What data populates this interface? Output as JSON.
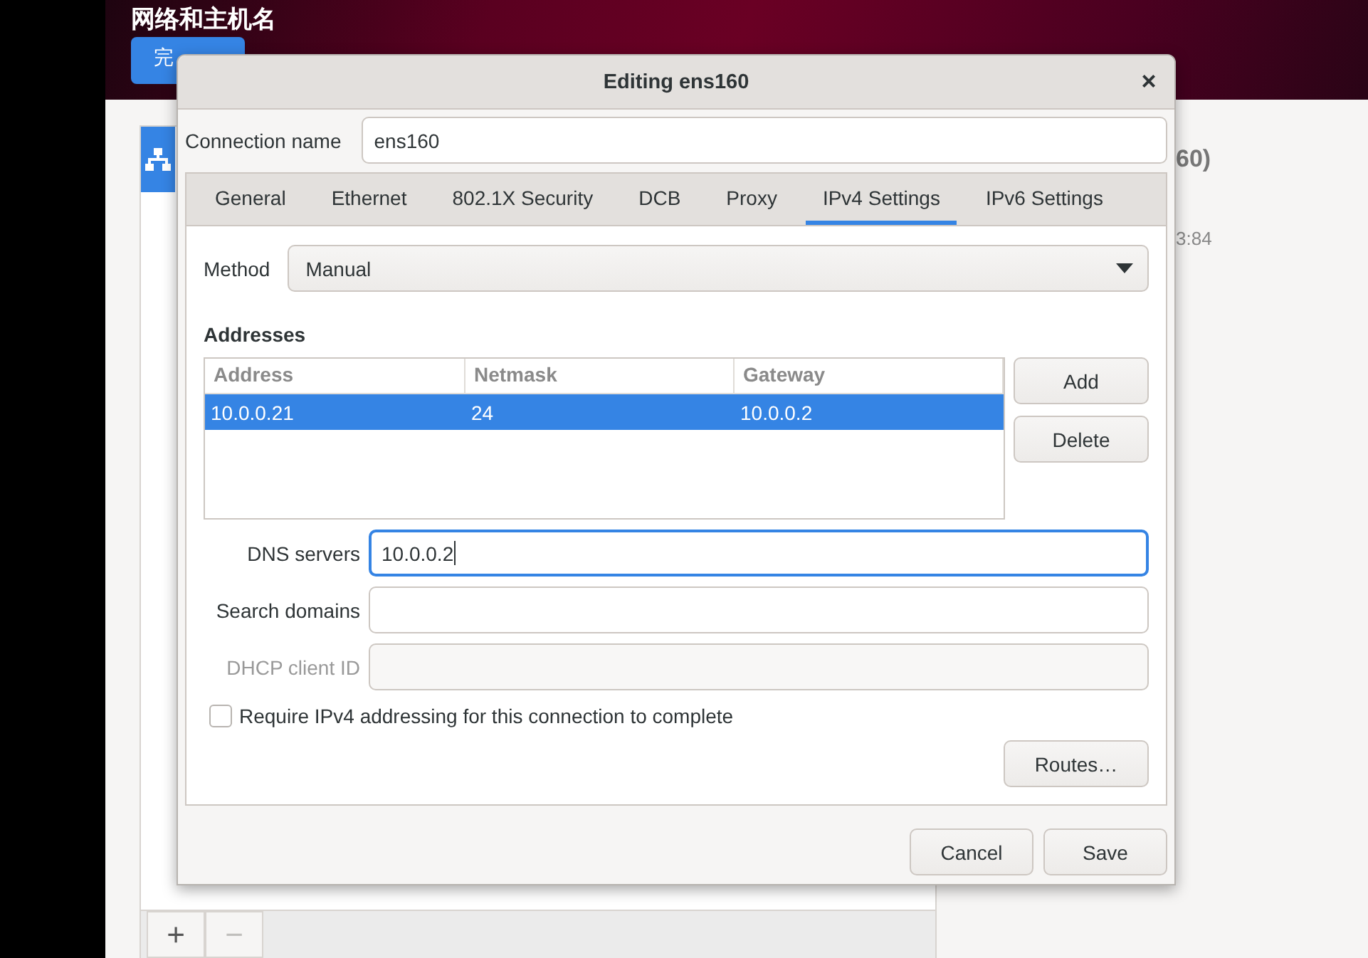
{
  "background": {
    "title": "网络和主机名",
    "done_button": "完",
    "list_item": {
      "selected": true
    },
    "partial_texts": [
      "60)",
      "3:84"
    ],
    "list_buttons": [
      {
        "label": "+",
        "disabled": false
      },
      {
        "label": "−",
        "disabled": true
      }
    ]
  },
  "dialog": {
    "title": "Editing ens160",
    "close": "×",
    "connection_name_label": "Connection name",
    "connection_name": "ens160",
    "tabs": [
      {
        "label": "General",
        "selected": false
      },
      {
        "label": "Ethernet",
        "selected": false
      },
      {
        "label": "802.1X Security",
        "selected": false
      },
      {
        "label": "DCB",
        "selected": false
      },
      {
        "label": "Proxy",
        "selected": false
      },
      {
        "label": "IPv4 Settings",
        "selected": true
      },
      {
        "label": "IPv6 Settings",
        "selected": false
      }
    ],
    "method_label": "Method",
    "method": "Manual",
    "addresses_heading": "Addresses",
    "columns": [
      "Address",
      "Netmask",
      "Gateway"
    ],
    "rows": [
      {
        "cells": [
          "10.0.0.21",
          "24",
          "10.0.0.2"
        ],
        "selected": true
      }
    ],
    "address_buttons": [
      "Add",
      "Delete"
    ],
    "fields": [
      {
        "label": "DNS servers",
        "value": "10.0.0.2",
        "focused": true,
        "disabled": false
      },
      {
        "label": "Search domains",
        "focused": false,
        "disabled": false
      },
      {
        "label": "DHCP client ID",
        "focused": false,
        "disabled": true
      }
    ],
    "require_checkbox": {
      "label": "Require IPv4 addressing for this connection to complete",
      "checked": false
    },
    "routes_button": "Routes…",
    "buttons": [
      "Cancel",
      "Save"
    ]
  }
}
